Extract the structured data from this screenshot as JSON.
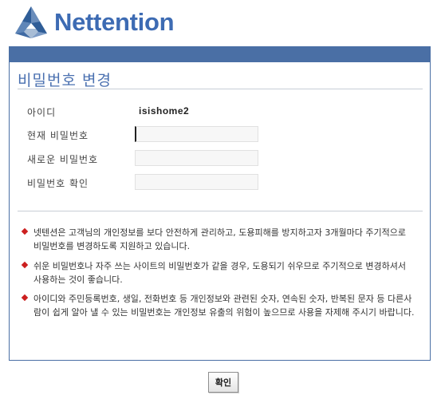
{
  "brand": {
    "name": "Nettention"
  },
  "page": {
    "title": "비밀번호 변경"
  },
  "form": {
    "id_label": "아이디",
    "id_value": "isishome2",
    "current_password_label": "현재 비밀번호",
    "new_password_label": "새로운 비밀번호",
    "confirm_password_label": "비밀번호 확인"
  },
  "notices": [
    "넷텐션은 고객님의 개인정보를 보다 안전하게 관리하고, 도용피해를 방지하고자 3개월마다 주기적으로 비밀번호를 변경하도록 지원하고 있습니다.",
    "쉬운 비밀번호나 자주 쓰는 사이트의 비밀번호가 같을 경우, 도용되기 쉬우므로 주기적으로 변경하셔서 사용하는 것이 좋습니다.",
    "아이디와 주민등록번호, 생일, 전화번호 등 개인정보와 관련된 숫자, 연속된 숫자, 반복된 문자 등 다른사람이 쉽게 알아 낼 수 있는 비밀번호는 개인정보 유출의 위험이 높으므로 사용을 자제해 주시기 바랍니다."
  ],
  "actions": {
    "confirm_label": "확인"
  },
  "colors": {
    "accent": "#4a6fa5",
    "title": "#4a70b0",
    "bullet": "#cc1f1f",
    "logo_text": "#3d6bb3"
  }
}
